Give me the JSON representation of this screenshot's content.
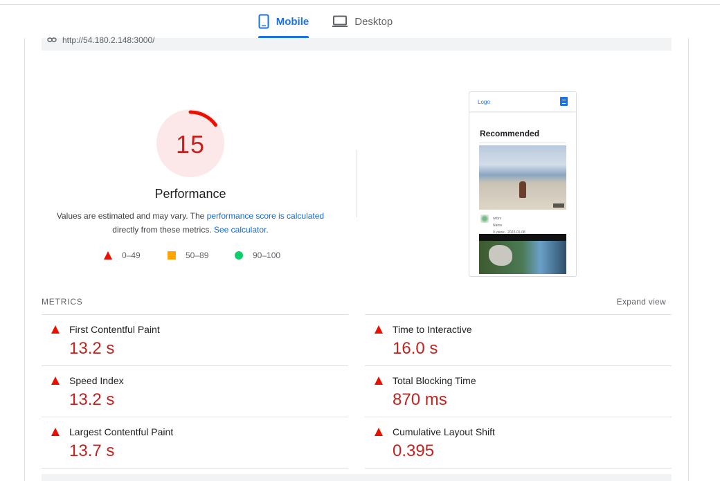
{
  "tabs": {
    "mobile_label": "Mobile",
    "desktop_label": "Desktop",
    "active": "Mobile"
  },
  "url_bar": {
    "url": "http://54.180.2.148:3000/"
  },
  "score": {
    "value": 15,
    "fraction": 0.15,
    "title": "Performance",
    "desc_prefix": "Values are estimated and may vary. The ",
    "desc_link1": "performance score is calculated",
    "desc_mid": "directly from these metrics. ",
    "desc_link2": "See calculator",
    "desc_suffix": ".",
    "colors": {
      "fail": "#c5221f",
      "fail_bg": "#fce8e8",
      "arc": "#eb0f00",
      "average": "#ffa400",
      "pass": "#0cce6b",
      "link": "#1967d2"
    }
  },
  "legend": [
    {
      "icon": "triangle-icon",
      "label": "0–49"
    },
    {
      "icon": "square-icon",
      "label": "50–89"
    },
    {
      "icon": "circle-icon",
      "label": "90–100"
    }
  ],
  "screenshot": {
    "logo": "Logo",
    "heading": "Recommended",
    "channel": "rwbrv",
    "video_name": "Name",
    "video_meta": "0 views · 2022-01-08"
  },
  "metrics": {
    "section_label": "METRICS",
    "expand_label": "Expand view",
    "items": [
      {
        "name": "First Contentful Paint",
        "value": "13.2 s"
      },
      {
        "name": "Time to Interactive",
        "value": "16.0 s"
      },
      {
        "name": "Speed Index",
        "value": "13.2 s"
      },
      {
        "name": "Total Blocking Time",
        "value": "870 ms"
      },
      {
        "name": "Largest Contentful Paint",
        "value": "13.7 s"
      },
      {
        "name": "Cumulative Layout Shift",
        "value": "0.395"
      }
    ]
  }
}
